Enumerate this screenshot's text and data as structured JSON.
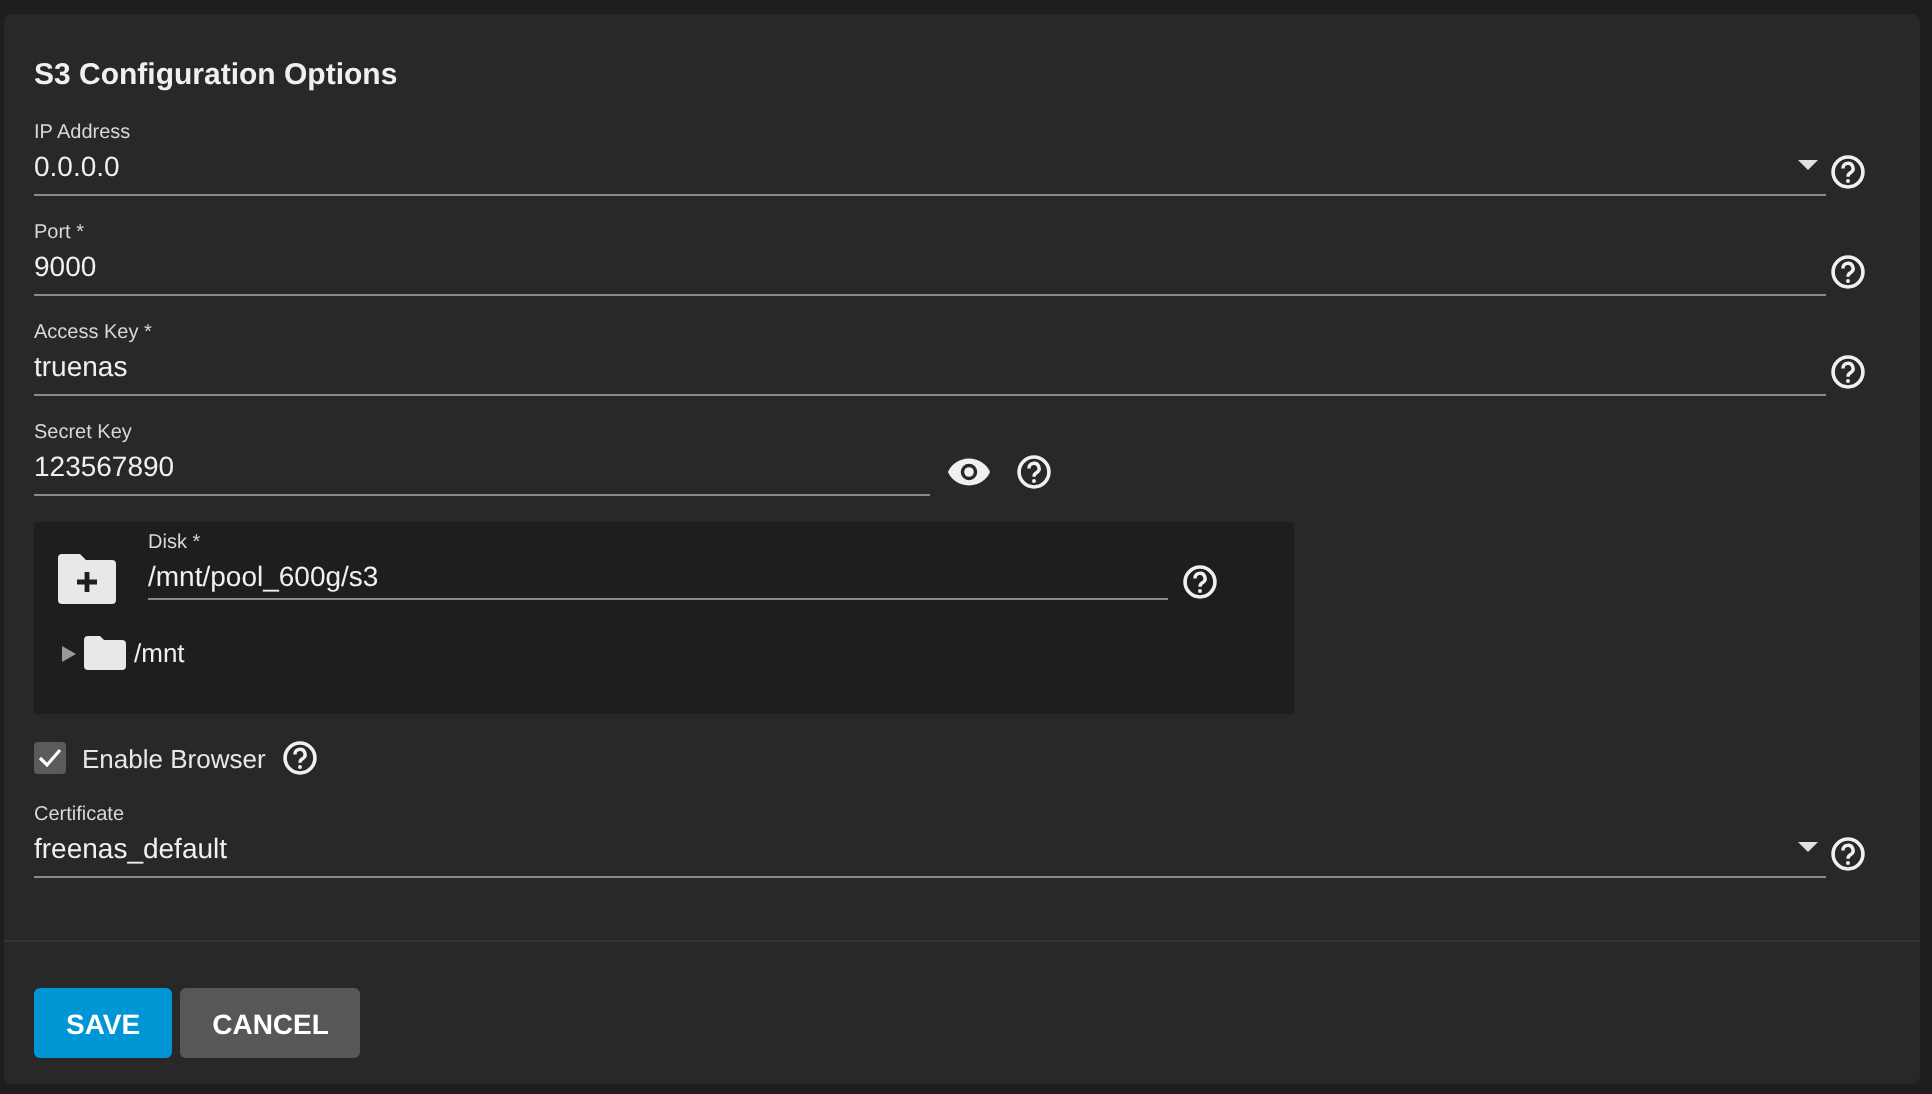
{
  "title": "S3 Configuration Options",
  "fields": [
    {
      "kind": "select",
      "label": "IP Address",
      "value": "0.0.0.0"
    },
    {
      "kind": "text",
      "label": "Port *",
      "value": "9000"
    },
    {
      "kind": "text",
      "label": "Access Key *",
      "value": "truenas"
    },
    {
      "kind": "password",
      "label": "Secret Key",
      "value": "123567890"
    },
    {
      "kind": "explorer",
      "label": "Disk *",
      "value": "/mnt/pool_600g/s3",
      "nodes": [
        {
          "label": "/mnt",
          "expanded": false
        }
      ]
    },
    {
      "kind": "checkbox",
      "label": "Enable Browser",
      "checked": true
    },
    {
      "kind": "select",
      "label": "Certificate",
      "value": "freenas_default"
    }
  ],
  "buttons": [
    {
      "label": "SAVE",
      "primary": true
    },
    {
      "label": "CANCEL",
      "primary": false
    }
  ]
}
